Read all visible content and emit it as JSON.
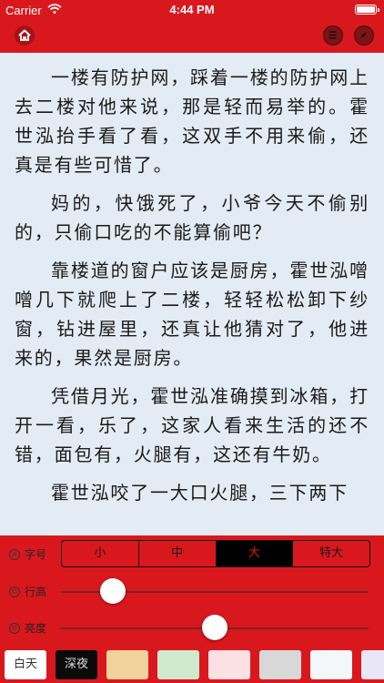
{
  "status": {
    "carrier": "Carrier",
    "time": "4:44 PM"
  },
  "navbar": {
    "home_icon": "home-icon",
    "menu_icon": "list-icon",
    "compass_icon": "compass-icon"
  },
  "content": {
    "paragraphs": [
      "一楼有防护网，踩着一楼的防护网上去二楼对他来说，那是轻而易举的。霍世泓抬手看了看，这双手不用来偷，还真是有些可惜了。",
      "妈的，快饿死了，小爷今天不偷别的，只偷口吃的不能算偷吧？",
      "靠楼道的窗户应该是厨房，霍世泓噌噌几下就爬上了二楼，轻轻松松卸下纱窗，钻进屋里，还真让他猜对了，他进来的，果然是厨房。",
      "凭借月光，霍世泓准确摸到冰箱，打开一看，乐了，这家人看来生活的还不错，面包有，火腿有，这还有牛奶。",
      "霍世泓咬了一大口火腿，三下两下"
    ]
  },
  "settings": {
    "font_size": {
      "icon_letter": "A",
      "label": "字号",
      "options": [
        "小",
        "中",
        "大",
        "特大"
      ],
      "selected_index": 2
    },
    "line_height": {
      "icon_letter": "©",
      "label": "行高",
      "value": 0.17
    },
    "brightness": {
      "icon_letter": "©",
      "label": "亮度",
      "value": 0.5
    },
    "themes": [
      {
        "label": "白天",
        "color": "#ffffff",
        "text_color": "#333333"
      },
      {
        "label": "深夜",
        "color": "#0a0a0a",
        "text_color": "#dddddd"
      },
      {
        "label": "",
        "color": "#f0d29a"
      },
      {
        "label": "",
        "color": "#cfe9cf"
      },
      {
        "label": "",
        "color": "#fbe1e3"
      },
      {
        "label": "",
        "color": "#d8d8d8"
      },
      {
        "label": "",
        "color": "#f3f7f9"
      },
      {
        "label": "",
        "color": "#e9e6f7"
      }
    ]
  },
  "colors": {
    "accent": "#d9181e",
    "page_bg": "#e3ecf5"
  }
}
